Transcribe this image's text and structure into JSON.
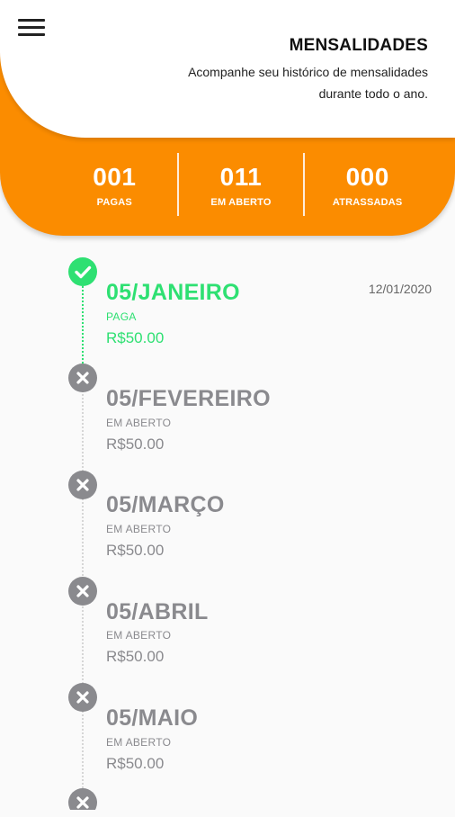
{
  "header": {
    "title": "MENSALIDADES",
    "subtitle_line1": "Acompanhe seu histórico de mensalidades",
    "subtitle_line2": "durante todo o ano.",
    "menu_icon": "hamburger-menu-icon"
  },
  "stats": [
    {
      "value": "001",
      "label": "PAGAS"
    },
    {
      "value": "011",
      "label": "EM ABERTO"
    },
    {
      "value": "000",
      "label": "ATRASSADAS"
    }
  ],
  "colors": {
    "accent": "#fb8c00",
    "paid": "#2ee072",
    "open": "#8a8a8e"
  },
  "timeline": [
    {
      "month": "05/JANEIRO",
      "status": "PAGA",
      "amount": "R$50.00",
      "date": "12/01/2020",
      "icon": "check-circle-icon"
    },
    {
      "month": "05/FEVEREIRO",
      "status": "EM ABERTO",
      "amount": "R$50.00",
      "icon": "x-circle-icon"
    },
    {
      "month": "05/MARÇO",
      "status": "EM ABERTO",
      "amount": "R$50.00",
      "icon": "x-circle-icon"
    },
    {
      "month": "05/ABRIL",
      "status": "EM ABERTO",
      "amount": "R$50.00",
      "icon": "x-circle-icon"
    },
    {
      "month": "05/MAIO",
      "status": "EM ABERTO",
      "amount": "R$50.00",
      "icon": "x-circle-icon"
    }
  ]
}
